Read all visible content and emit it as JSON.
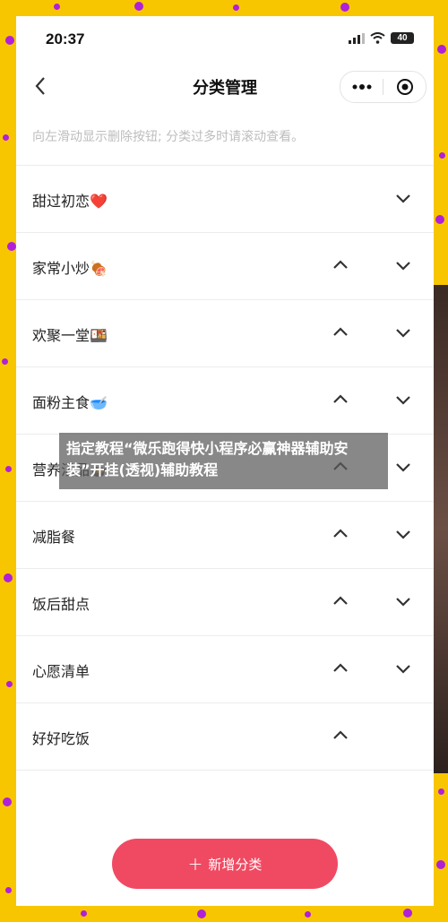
{
  "status_bar": {
    "time": "20:37",
    "battery": "40"
  },
  "navbar": {
    "title": "分类管理",
    "back_icon": "chevron-left-icon",
    "more_icon": "more-dots-icon",
    "close_icon": "target-circle-icon"
  },
  "hint": "向左滑动显示删除按钮; 分类过多时请滚动查看。",
  "categories": [
    {
      "label": "甜过初恋❤️",
      "up": false,
      "down": true
    },
    {
      "label": "家常小炒🍖",
      "up": true,
      "down": true
    },
    {
      "label": "欢聚一堂🍱",
      "up": true,
      "down": true
    },
    {
      "label": "面粉主食🥣",
      "up": true,
      "down": true
    },
    {
      "label": "营养汤品🍲",
      "up": true,
      "down": true
    },
    {
      "label": "减脂餐",
      "up": true,
      "down": true
    },
    {
      "label": "饭后甜点",
      "up": true,
      "down": true
    },
    {
      "label": "心愿清单",
      "up": true,
      "down": true
    },
    {
      "label": "好好吃饭",
      "up": true,
      "down": false
    }
  ],
  "add_button": {
    "label": "新增分类",
    "icon": "plus-icon"
  },
  "overlay_banner": "指定教程“微乐跑得快小程序必赢神器辅助安装”开挂(透视)辅助教程",
  "colors": {
    "frame": "#f7c600",
    "accent": "#f04a62",
    "dots": "#b020d8"
  }
}
